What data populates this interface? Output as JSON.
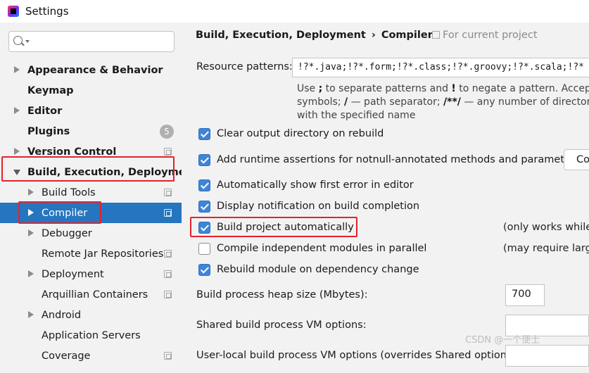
{
  "window": {
    "title": "Settings"
  },
  "sidebar": {
    "items": [
      {
        "label": "Appearance & Behavior"
      },
      {
        "label": "Keymap"
      },
      {
        "label": "Editor"
      },
      {
        "label": "Plugins",
        "badge": "5"
      },
      {
        "label": "Version Control"
      },
      {
        "label": "Build, Execution, Deployment"
      },
      {
        "label": "Build Tools"
      },
      {
        "label": "Compiler"
      },
      {
        "label": "Debugger"
      },
      {
        "label": "Remote Jar Repositories"
      },
      {
        "label": "Deployment"
      },
      {
        "label": "Arquillian Containers"
      },
      {
        "label": "Android"
      },
      {
        "label": "Application Servers"
      },
      {
        "label": "Coverage"
      }
    ]
  },
  "main": {
    "breadcrumb": {
      "parent": "Build, Execution, Deployment",
      "separator": "›",
      "current": "Compiler"
    },
    "scope_note": "For current project",
    "resource_patterns": {
      "label": "Resource patterns:",
      "value": "!?*.java;!?*.form;!?*.class;!?*.groovy;!?*.scala;!?*",
      "hint": {
        "line1_a": "Use ",
        "sep1": ";",
        "line1_b": " to separate patterns and ",
        "sep2": "!",
        "line1_c": " to negate a pattern. Accepted",
        "line2_a": "symbols; ",
        "sym1": "/",
        "line2_b": " — path separator; ",
        "sym2": "/**/",
        "line2_c": " — any number of directorie",
        "line3": "with the specified name"
      }
    },
    "options": [
      {
        "label": "Clear output directory on rebuild",
        "checked": true
      },
      {
        "label": "Add runtime assertions for notnull-annotated methods and parameters",
        "checked": true
      },
      {
        "label": "Automatically show first error in editor",
        "checked": true
      },
      {
        "label": "Display notification on build completion",
        "checked": true
      },
      {
        "label": "Build project automatically",
        "checked": true
      },
      {
        "label": "Compile independent modules in parallel",
        "checked": false
      },
      {
        "label": "Rebuild module on dependency change",
        "checked": true
      }
    ],
    "assertions_button": "Co",
    "notes": {
      "build_auto": "(only works while",
      "parallel": "(may require large"
    },
    "heap_size": {
      "label": "Build process heap size (Mbytes):",
      "value": "700"
    },
    "shared_vm": {
      "label": "Shared build process VM options:",
      "value": ""
    },
    "user_vm": {
      "label": "User-local build process VM options (overrides Shared options):",
      "value": ""
    }
  },
  "watermark": "CSDN @一个便士",
  "colors": {
    "selection": "#2675bf",
    "checkbox": "#3d85d8",
    "highlight_box": "#e5222a"
  }
}
